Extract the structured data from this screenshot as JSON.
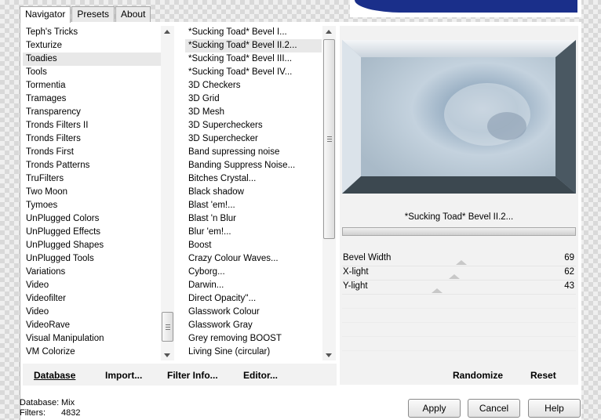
{
  "tabs": [
    {
      "label": "Navigator",
      "active": true
    },
    {
      "label": "Presets",
      "active": false
    },
    {
      "label": "About",
      "active": false
    }
  ],
  "categories": {
    "items": [
      {
        "label": "Teph's Tricks",
        "selected": false
      },
      {
        "label": "Texturize",
        "selected": false
      },
      {
        "label": "Toadies",
        "selected": true
      },
      {
        "label": "Tools",
        "selected": false
      },
      {
        "label": "Tormentia",
        "selected": false
      },
      {
        "label": "Tramages",
        "selected": false
      },
      {
        "label": "Transparency",
        "selected": false
      },
      {
        "label": "Tronds Filters II",
        "selected": false
      },
      {
        "label": "Tronds Filters",
        "selected": false
      },
      {
        "label": "Tronds First",
        "selected": false
      },
      {
        "label": "Tronds Patterns",
        "selected": false
      },
      {
        "label": "TruFilters",
        "selected": false
      },
      {
        "label": "Two Moon",
        "selected": false
      },
      {
        "label": "Tymoes",
        "selected": false
      },
      {
        "label": "UnPlugged Colors",
        "selected": false
      },
      {
        "label": "UnPlugged Effects",
        "selected": false
      },
      {
        "label": "UnPlugged Shapes",
        "selected": false
      },
      {
        "label": "UnPlugged Tools",
        "selected": false
      },
      {
        "label": "Variations",
        "selected": false
      },
      {
        "label": "Video",
        "selected": false
      },
      {
        "label": "Videofilter",
        "selected": false
      },
      {
        "label": "Video",
        "selected": false
      },
      {
        "label": "VideoRave",
        "selected": false
      },
      {
        "label": "Visual Manipulation",
        "selected": false
      },
      {
        "label": "VM Colorize",
        "selected": false
      }
    ]
  },
  "filters": {
    "items": [
      {
        "label": "*Sucking Toad*  Bevel I...",
        "selected": false
      },
      {
        "label": "*Sucking Toad*  Bevel II.2...",
        "selected": true
      },
      {
        "label": "*Sucking Toad*  Bevel III...",
        "selected": false
      },
      {
        "label": "*Sucking Toad*  Bevel IV...",
        "selected": false
      },
      {
        "label": "3D Checkers",
        "selected": false
      },
      {
        "label": "3D Grid",
        "selected": false
      },
      {
        "label": "3D Mesh",
        "selected": false
      },
      {
        "label": "3D Supercheckers",
        "selected": false
      },
      {
        "label": "3D Superchecker",
        "selected": false
      },
      {
        "label": "Band supressing noise",
        "selected": false
      },
      {
        "label": "Banding Suppress Noise...",
        "selected": false
      },
      {
        "label": "Bitches Crystal...",
        "selected": false
      },
      {
        "label": "Black shadow",
        "selected": false
      },
      {
        "label": "Blast 'em!...",
        "selected": false
      },
      {
        "label": "Blast 'n Blur",
        "selected": false
      },
      {
        "label": "Blur 'em!...",
        "selected": false
      },
      {
        "label": "Boost",
        "selected": false
      },
      {
        "label": "Crazy Colour Waves...",
        "selected": false
      },
      {
        "label": "Cyborg...",
        "selected": false
      },
      {
        "label": "Darwin...",
        "selected": false
      },
      {
        "label": "Direct Opacity''...",
        "selected": false
      },
      {
        "label": "Glasswork Colour",
        "selected": false
      },
      {
        "label": "Glasswork Gray",
        "selected": false
      },
      {
        "label": "Grey removing BOOST",
        "selected": false
      },
      {
        "label": "Living Sine (circular)",
        "selected": false
      }
    ]
  },
  "list_buttons": {
    "database": "Database",
    "import": "Import...",
    "filter_info": "Filter Info...",
    "editor": "Editor..."
  },
  "preview": {
    "filter_name": "*Sucking Toad*  Bevel II.2..."
  },
  "parameters": [
    {
      "label": "Bevel Width",
      "value": "69",
      "level": 69
    },
    {
      "label": "X-light",
      "value": "62",
      "level": 62
    },
    {
      "label": "Y-light",
      "value": "43",
      "level": 43
    }
  ],
  "preview_buttons": {
    "randomize": "Randomize",
    "reset": "Reset"
  },
  "status": {
    "database_label": "Database:",
    "database_value": "Mix",
    "filters_label": "Filters:",
    "filters_value": "4832"
  },
  "dialog_buttons": {
    "apply": "Apply",
    "cancel": "Cancel",
    "help": "Help"
  }
}
